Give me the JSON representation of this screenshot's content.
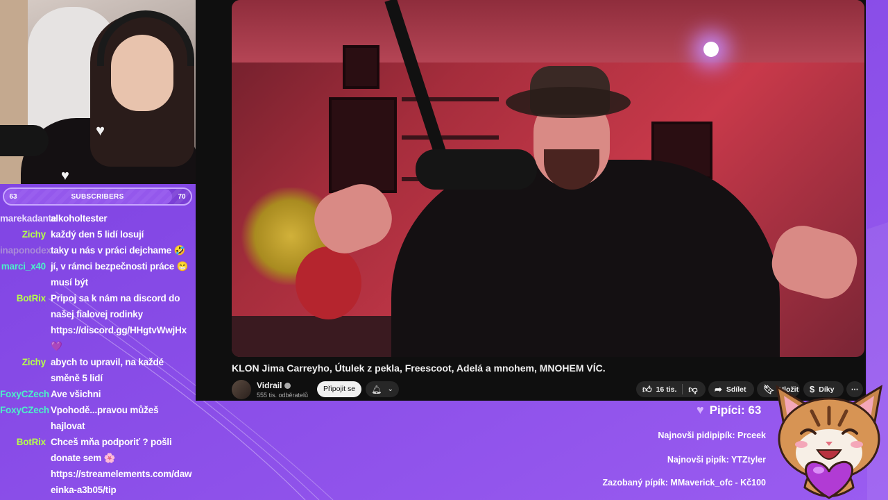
{
  "subscribers": {
    "left": "63",
    "label": "SUBSCRIBERS",
    "right": "70",
    "progress": 0.9
  },
  "chat": [
    {
      "user": "marekadante",
      "color": "#e9ddff",
      "text": "alkoholtester"
    },
    {
      "user": "Zichy",
      "color": "#b6ff4a",
      "text": "každý den 5 lidí losují"
    },
    {
      "user": "inaponodex",
      "color": "#a98bd8",
      "text": "taky u nás v práci dejchame 🤣"
    },
    {
      "user": "marci_x40",
      "color": "#4cf0c8",
      "text": "jí, v rámci bezpečnosti práce 😁 musí být"
    },
    {
      "user": "BotRix",
      "color": "#b6ff4a",
      "text": "Pripoj sa k nám na discord do našej fialovej rodinky https://discord.gg/HHgtvWwjHx 💜"
    },
    {
      "user": "Zichy",
      "color": "#b6ff4a",
      "text": "abych to upravil, na každé směně 5 lidí"
    },
    {
      "user": "FoxyCZech",
      "color": "#4cf0c8",
      "text": "Ave všichni"
    },
    {
      "user": "FoxyCZech",
      "color": "#4cf0c8",
      "text": "Vpohodě...pravou můžeš hajlovat"
    },
    {
      "user": "BotRix",
      "color": "#b6ff4a",
      "text": "Chceš mňa podporiť ? pošli donate sem 🌸 https://streamelements.com/daweinka-a3b05/tip"
    }
  ],
  "video": {
    "title": "KLON Jima Carreyho, Útulek z pekla, Freescoot, Adelá a mnohem, MNOHEM VÍC.",
    "channel": "Vidrail",
    "subscribers": "555 tis. odběratelů",
    "join_label": "Připojit se",
    "likes": "16 tis.",
    "share_label": "Sdílet",
    "save_label": "Uložit",
    "thanks_label": "Díky"
  },
  "overlay": {
    "pipici": "Pipíci: 63",
    "latest_follower": "Najnovši pidipipík: Prceek",
    "latest_sub": "Najnovši pipík: YTZtyler",
    "latest_donation": "Zazobaný pípík: MMaverick_ofc - Kč100"
  }
}
